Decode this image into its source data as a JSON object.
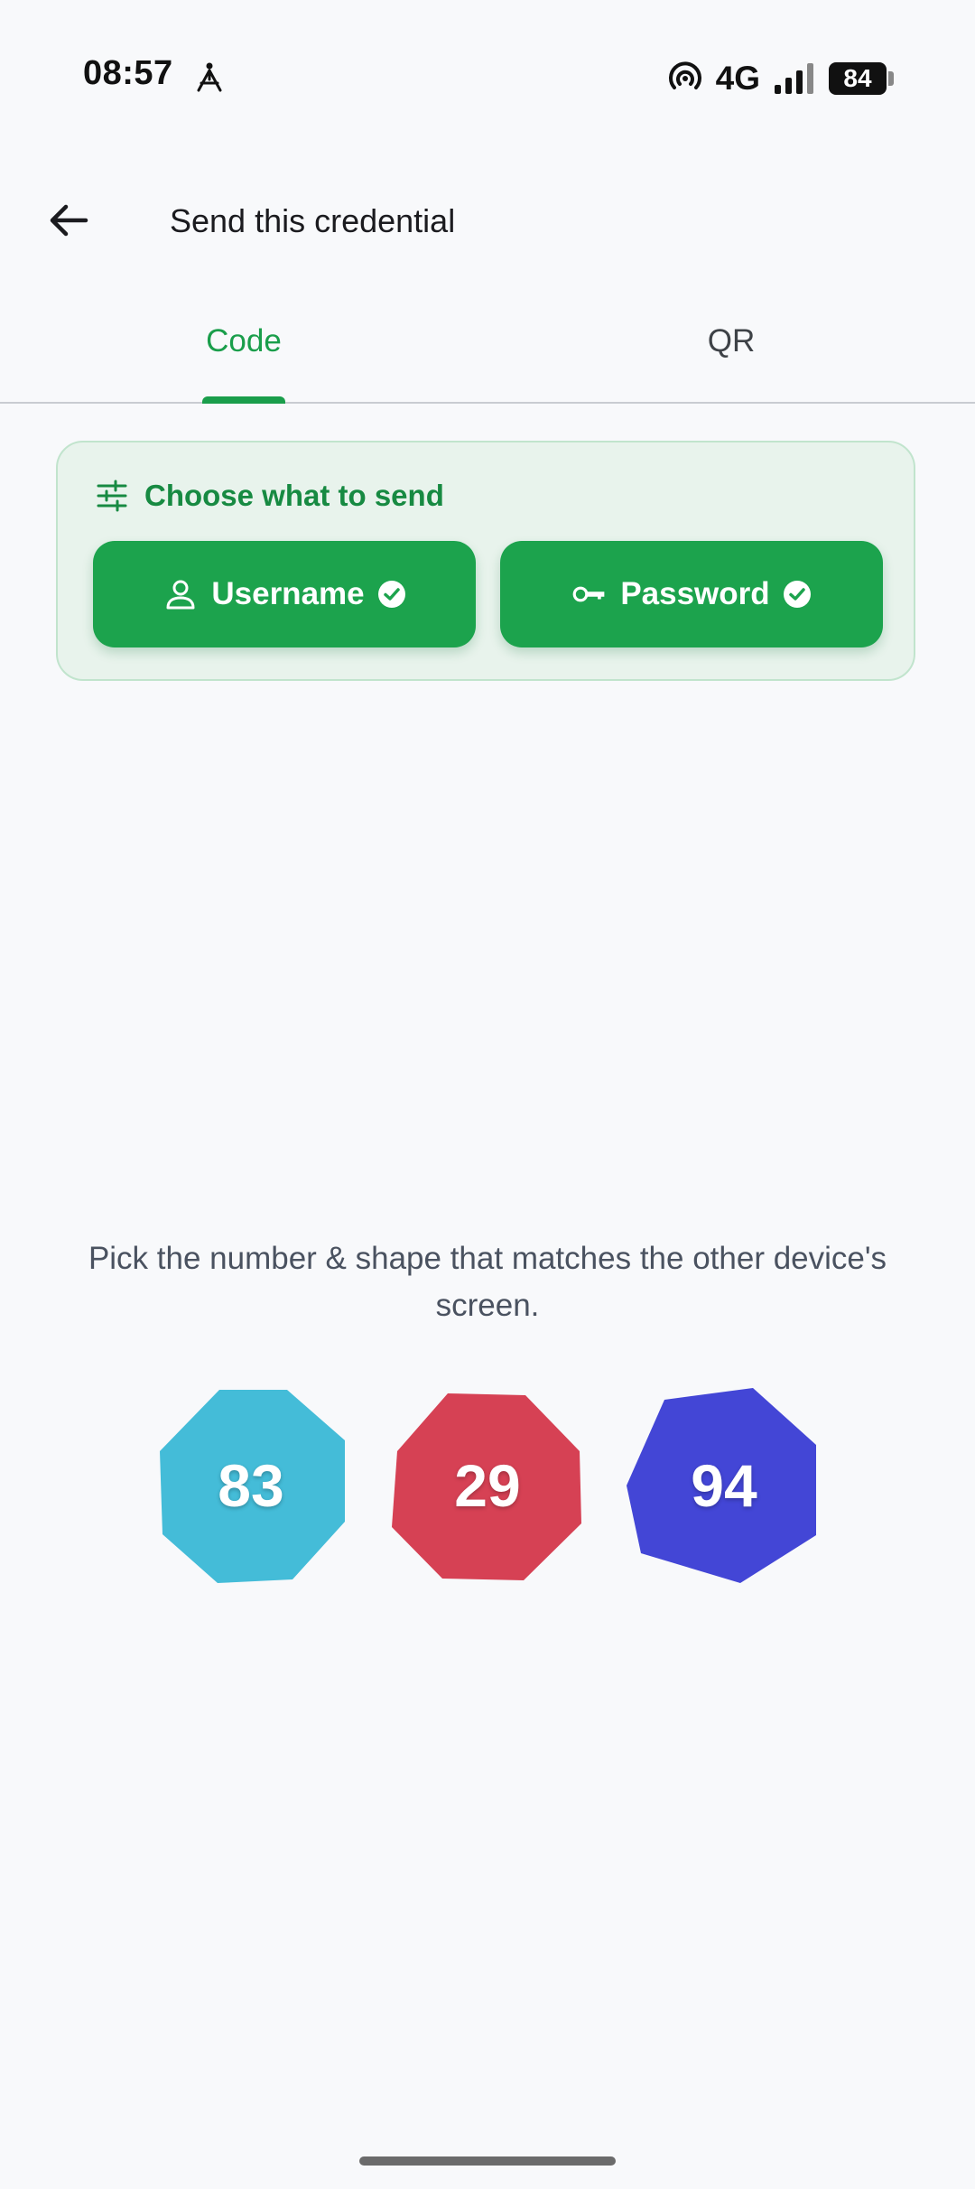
{
  "status_bar": {
    "time": "08:57",
    "network": "4G",
    "battery": "84"
  },
  "app_bar": {
    "title": "Send this credential"
  },
  "tabs": [
    {
      "label": "Code",
      "selected": true
    },
    {
      "label": "QR",
      "selected": false
    }
  ],
  "choose": {
    "label": "Choose what to send",
    "options": [
      {
        "label": "Username",
        "icon": "person-icon",
        "selected": true
      },
      {
        "label": "Password",
        "icon": "key-icon",
        "selected": true
      }
    ]
  },
  "instruction": "Pick the number & shape that matches the other device's screen.",
  "shapes": [
    {
      "number": "83",
      "color": "#44bcd8",
      "shape": "octagon"
    },
    {
      "number": "29",
      "color": "#d64154",
      "shape": "octagon"
    },
    {
      "number": "94",
      "color": "#4346d6",
      "shape": "heptagon"
    }
  ],
  "colors": {
    "accent": "#1a9e4b",
    "button": "#1ca34d",
    "card_bg": "#e8f3ec"
  }
}
